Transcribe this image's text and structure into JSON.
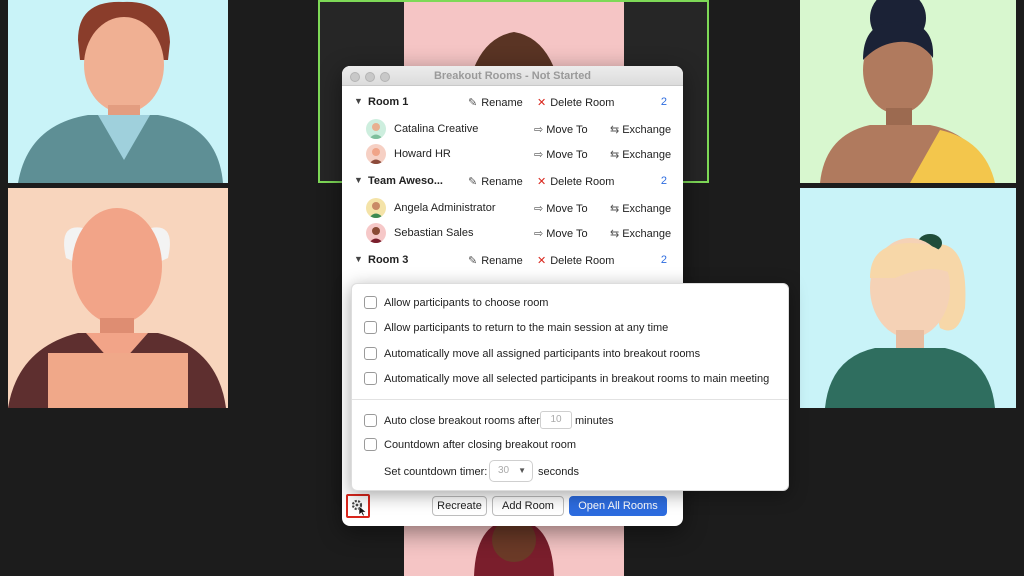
{
  "window": {
    "title": "Breakout Rooms - Not Started"
  },
  "rooms": [
    {
      "name": "Room 1",
      "rename_label": "Rename",
      "delete_label": "Delete Room",
      "count": "2",
      "participants": [
        {
          "name": "Catalina Creative",
          "move_label": "Move To",
          "exchange_label": "Exchange"
        },
        {
          "name": "Howard HR",
          "move_label": "Move To",
          "exchange_label": "Exchange"
        }
      ]
    },
    {
      "name": "Team Aweso...",
      "rename_label": "Rename",
      "delete_label": "Delete Room",
      "count": "2",
      "participants": [
        {
          "name": "Angela Administrator",
          "move_label": "Move To",
          "exchange_label": "Exchange"
        },
        {
          "name": "Sebastian Sales",
          "move_label": "Move To",
          "exchange_label": "Exchange"
        }
      ]
    },
    {
      "name": "Room 3",
      "rename_label": "Rename",
      "delete_label": "Delete Room",
      "count": "2",
      "participants": []
    }
  ],
  "settings": {
    "options": [
      "Allow participants to choose room",
      "Allow participants to return to the main session at any time",
      "Automatically move all assigned participants into breakout rooms",
      "Automatically move all selected participants in breakout rooms to main meeting"
    ],
    "auto_close_label": "Auto close breakout rooms after",
    "auto_close_value": "10",
    "auto_close_unit": "minutes",
    "countdown_label": "Countdown after closing breakout room",
    "timer_label": "Set countdown timer:",
    "timer_value": "30",
    "timer_unit": "seconds"
  },
  "buttons": {
    "recreate": "Recreate",
    "add_room": "Add Room",
    "open_all": "Open All Rooms"
  },
  "icons": {
    "rename": "pencil-icon",
    "delete": "x-icon",
    "move": "move-to-icon",
    "exchange": "exchange-icon",
    "settings": "gear-icon"
  },
  "colors": {
    "accent": "#2d6cdf",
    "highlight": "#d9261c",
    "active_speaker": "#7ed957"
  }
}
